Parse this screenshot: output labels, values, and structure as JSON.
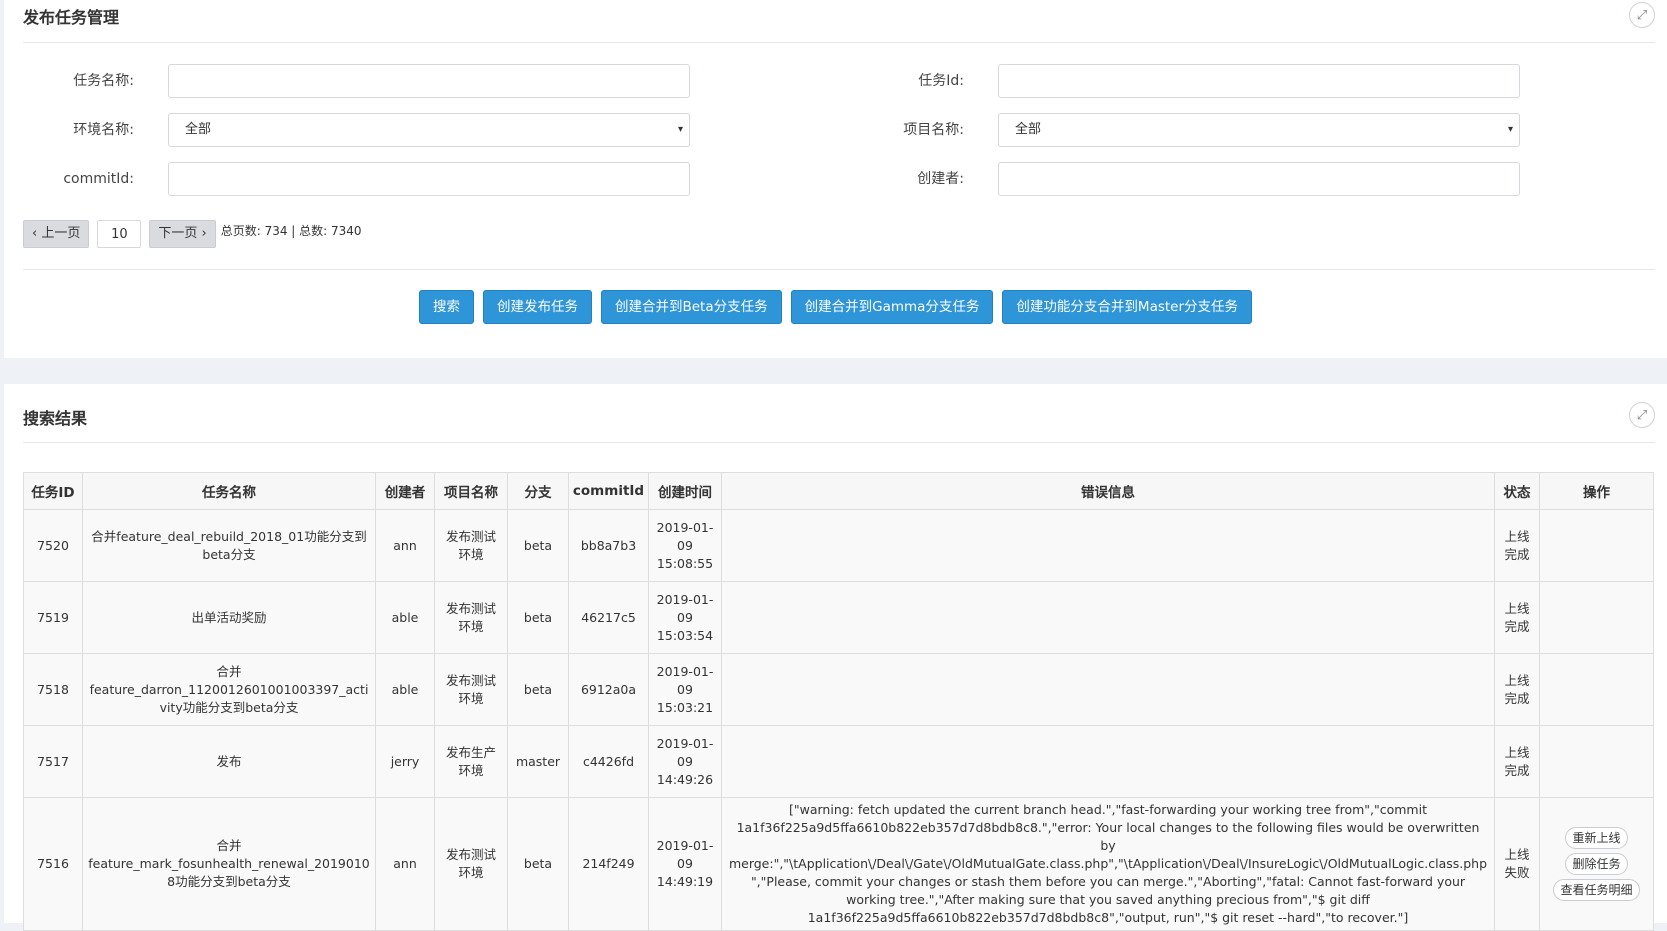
{
  "panel1": {
    "title": "发布任务管理"
  },
  "form": {
    "task_name_label": "任务名称:",
    "task_id_label": "任务Id:",
    "env_label": "环境名称:",
    "env_value": "全部",
    "project_label": "项目名称:",
    "project_value": "全部",
    "commit_label": "commitId:",
    "creator_label": "创建者:"
  },
  "pager": {
    "prev_label": "上一页",
    "page_size": "10",
    "next_label": "下一页",
    "info": "总页数: 734 | 总数:   7340"
  },
  "buttons": {
    "search": "搜索",
    "create_release": "创建发布任务",
    "merge_beta": "创建合并到Beta分支任务",
    "merge_gamma": "创建合并到Gamma分支任务",
    "merge_master": "创建功能分支合并到Master分支任务"
  },
  "panel2": {
    "title": "搜索结果"
  },
  "table": {
    "headers": [
      "任务ID",
      "任务名称",
      "创建者",
      "项目名称",
      "分支",
      "commitId",
      "创建时间",
      "错误信息",
      "状态",
      "操作"
    ],
    "rows": [
      {
        "id": "7520",
        "name": "合并feature_deal_rebuild_2018_01功能分支到beta分支",
        "creator": "ann",
        "project": "发布测试环境",
        "branch": "beta",
        "commit": "bb8a7b3",
        "time": "2019-01-09 15:08:55",
        "error": "",
        "status": "上线完成"
      },
      {
        "id": "7519",
        "name": "出单活动奖励",
        "creator": "able",
        "project": "发布测试环境",
        "branch": "beta",
        "commit": "46217c5",
        "time": "2019-01-09 15:03:54",
        "error": "",
        "status": "上线完成"
      },
      {
        "id": "7518",
        "name": "合并feature_darron_1120012601001003397_activity功能分支到beta分支",
        "creator": "able",
        "project": "发布测试环境",
        "branch": "beta",
        "commit": "6912a0a",
        "time": "2019-01-09 15:03:21",
        "error": "",
        "status": "上线完成"
      },
      {
        "id": "7517",
        "name": "发布",
        "creator": "jerry",
        "project": "发布生产环境",
        "branch": "master",
        "commit": "c4426fd",
        "time": "2019-01-09 14:49:26",
        "error": "",
        "status": "上线完成"
      },
      {
        "id": "7516",
        "name": "合并feature_mark_fosunhealth_renewal_20190108功能分支到beta分支",
        "creator": "ann",
        "project": "发布测试环境",
        "branch": "beta",
        "commit": "214f249",
        "time": "2019-01-09 14:49:19",
        "error": "[\"warning: fetch updated the current branch head.\",\"fast-forwarding your working tree from\",\"commit 1a1f36f225a9d5ffa6610b822eb357d7d8bdb8c8.\",\"error: Your local changes to the following files would be overwritten by merge:\",\"\\tApplication\\/Deal\\/Gate\\/OldMutualGate.class.php\",\"\\tApplication\\/Deal\\/InsureLogic\\/OldMutualLogic.class.php\",\"Please, commit your changes or stash them before you can merge.\",\"Aborting\",\"fatal: Cannot fast-forward your working tree.\",\"After making sure that you saved anything precious from\",\"$ git diff 1a1f36f225a9d5ffa6610b822eb357d7d8bdb8c8\",\"output, run\",\"$ git reset --hard\",\"to recover.\"]",
        "status": "上线失败",
        "ops": [
          "重新上线",
          "删除任务",
          "查看任务明细"
        ]
      }
    ]
  }
}
